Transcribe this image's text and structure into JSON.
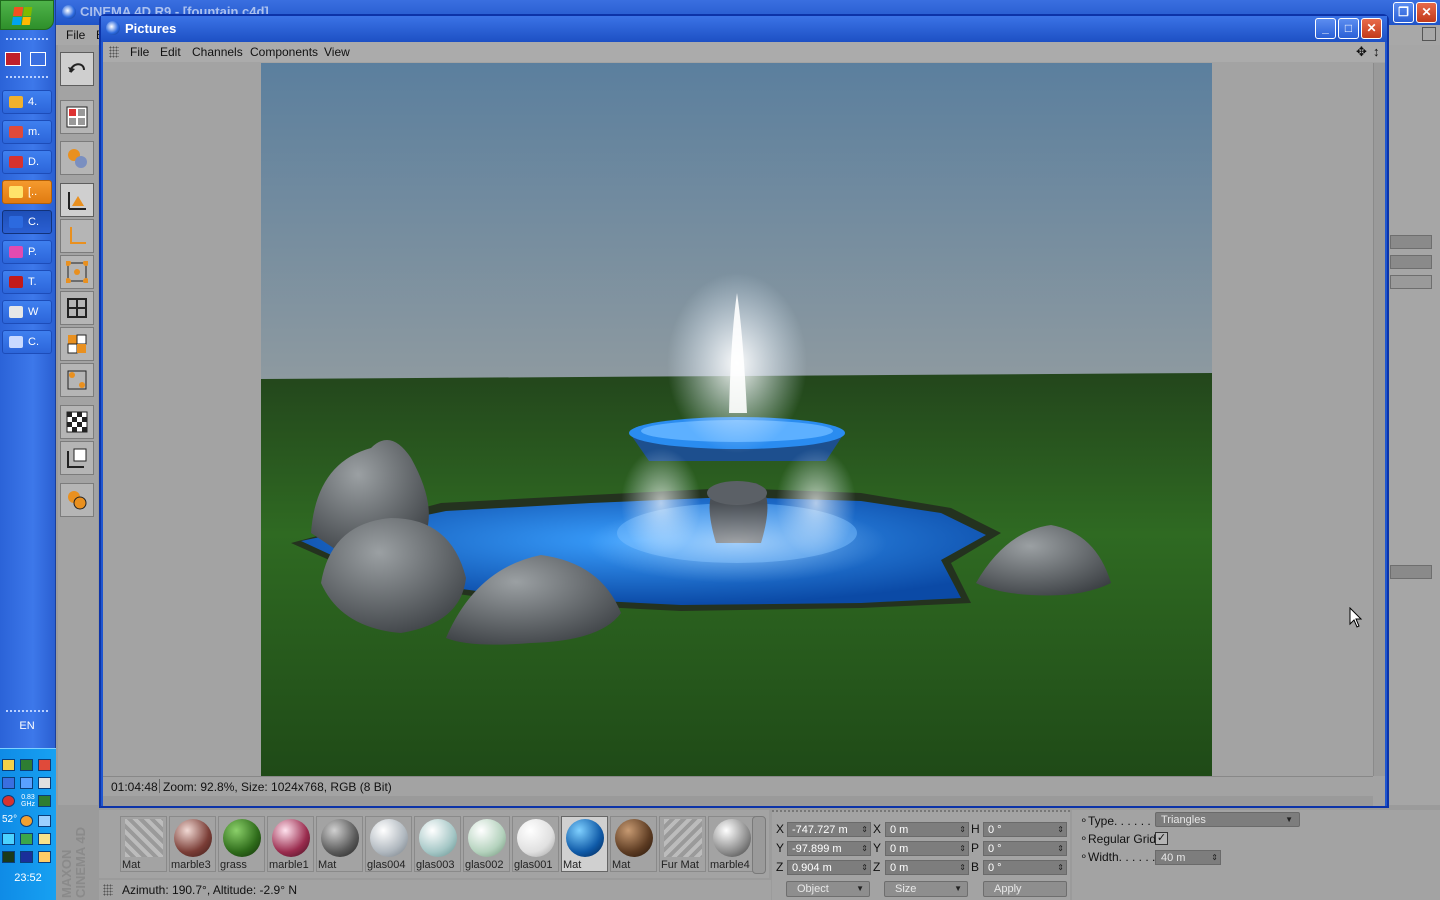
{
  "taskbar": {
    "tasks": [
      {
        "label": "4.",
        "color": "#f2b12e"
      },
      {
        "label": "m.",
        "color": "#e04a3a"
      },
      {
        "label": "D.",
        "color": "#d7322f"
      },
      {
        "label": "[..",
        "color": "#ffe36a"
      },
      {
        "label": "C.",
        "color": "#2c6adf"
      },
      {
        "label": "P.",
        "color": "#e24bb0"
      },
      {
        "label": "T.",
        "color": "#c21a1a"
      },
      {
        "label": "W",
        "color": "#e7e7e7"
      },
      {
        "label": "C.",
        "color": "#c9d9ff"
      }
    ],
    "language": "EN",
    "clock": "23:52",
    "temperature": "52°",
    "cpu": "0.83 GHz"
  },
  "main_window": {
    "title": "CINEMA 4D R9 - [fountain.c4d]",
    "menu": [
      "File",
      "E"
    ]
  },
  "pictures_window": {
    "title": "Pictures",
    "menu": [
      "File",
      "Edit",
      "Channels",
      "Components",
      "View"
    ],
    "status_time": "01:04:48",
    "status_info": "Zoom: 92.8%, Size: 1024x768, RGB (8 Bit)"
  },
  "materials": [
    {
      "label": "Mat",
      "icon": "grass-tuft"
    },
    {
      "label": "marble3",
      "icon": "marble-red"
    },
    {
      "label": "grass",
      "icon": "green"
    },
    {
      "label": "marble1",
      "icon": "marble-magenta"
    },
    {
      "label": "Mat",
      "icon": "grey-rock"
    },
    {
      "label": "glas004",
      "icon": "glass"
    },
    {
      "label": "glas003",
      "icon": "glass-teal"
    },
    {
      "label": "glas002",
      "icon": "glass-green"
    },
    {
      "label": "glas001",
      "icon": "glass-white"
    },
    {
      "label": "Mat",
      "icon": "water-blue",
      "selected": true
    },
    {
      "label": "Mat",
      "icon": "brown"
    },
    {
      "label": "Fur Mat",
      "icon": "fur-strand"
    },
    {
      "label": "marble4",
      "icon": "marble-grey"
    }
  ],
  "branding": "MAXON CINEMA 4D",
  "coordinates": {
    "rows": [
      {
        "axis": "X",
        "pos": "-747.727 m",
        "size_axis": "X",
        "size": "0 m",
        "rot_axis": "H",
        "rot": "0 °"
      },
      {
        "axis": "Y",
        "pos": "-97.899 m",
        "size_axis": "Y",
        "size": "0 m",
        "rot_axis": "P",
        "rot": "0 °"
      },
      {
        "axis": "Z",
        "pos": "0.904 m",
        "size_axis": "Z",
        "size": "0 m",
        "rot_axis": "B",
        "rot": "0 °"
      }
    ],
    "mode_select": "Object",
    "size_select": "Size",
    "apply": "Apply"
  },
  "attributes": {
    "type_label": "Type. . . . . . .",
    "type_value": "Triangles",
    "grid_label": "Regular Grid",
    "grid_checked": true,
    "width_label": "Width. . . . . . . .",
    "width_value": "40 m"
  },
  "status_bar": "Azimuth: 190.7°, Altitude: -2.9°  N"
}
